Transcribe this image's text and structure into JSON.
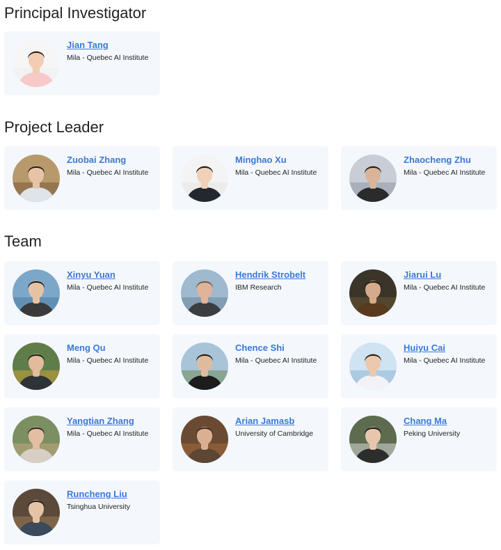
{
  "sections": [
    {
      "title": "Principal Investigator"
    },
    {
      "title": "Project Leader"
    },
    {
      "title": "Team"
    }
  ],
  "people": [
    {
      "name": "Jian Tang",
      "affiliation": "Mila - Quebec AI Institute",
      "link": true
    },
    {
      "name": "Zuobai Zhang",
      "affiliation": "Mila - Quebec AI Institute",
      "link": false
    },
    {
      "name": "Minghao Xu",
      "affiliation": "Mila - Quebec AI Institute",
      "link": false
    },
    {
      "name": "Zhaocheng Zhu",
      "affiliation": "Mila - Quebec AI Institute",
      "link": false
    },
    {
      "name": "Xinyu Yuan",
      "affiliation": "Mila - Quebec AI Institute",
      "link": true
    },
    {
      "name": "Hendrik Strobelt",
      "affiliation": "IBM Research",
      "link": true
    },
    {
      "name": "Jiarui Lu",
      "affiliation": "Mila - Quebec AI Institute",
      "link": true
    },
    {
      "name": "Meng Qu",
      "affiliation": "Mila - Quebec AI Institute",
      "link": false
    },
    {
      "name": "Chence Shi",
      "affiliation": "Mila - Quebec AI Institute",
      "link": false
    },
    {
      "name": "Huiyu Cai",
      "affiliation": "Mila - Quebec AI Institute",
      "link": true
    },
    {
      "name": "Yangtian Zhang",
      "affiliation": "Mila - Quebec AI Institute",
      "link": true
    },
    {
      "name": "Arian Jamasb",
      "affiliation": "University of Cambridge",
      "link": true
    },
    {
      "name": "Chang Ma",
      "affiliation": "Peking University",
      "link": true
    },
    {
      "name": "Runcheng Liu",
      "affiliation": "Tsinghua University",
      "link": true
    }
  ]
}
